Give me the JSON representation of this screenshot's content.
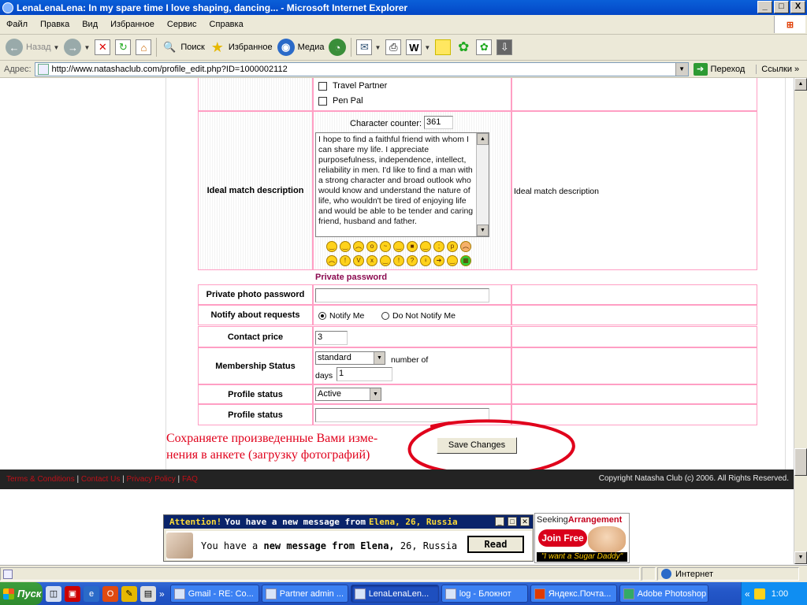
{
  "window": {
    "title": "LenaLenaLena: In my spare time I love shaping, dancing... - Microsoft Internet Explorer",
    "min": "_",
    "max": "□",
    "close": "X"
  },
  "menu": [
    "Файл",
    "Правка",
    "Вид",
    "Избранное",
    "Сервис",
    "Справка"
  ],
  "toolbar": {
    "back": "Назад",
    "search": "Поиск",
    "favorites": "Избранное",
    "media": "Медиа"
  },
  "address": {
    "label": "Адрес:",
    "url": "http://www.natashaclub.com/profile_edit.php?ID=1000002112",
    "go": "Переход",
    "links": "Ссылки"
  },
  "form": {
    "purpose_options": [
      {
        "label": "Travel Partner",
        "checked": false
      },
      {
        "label": "Pen Pal",
        "checked": false
      }
    ],
    "counter_label": "Character counter:",
    "counter_value": "361",
    "ideal_label": "Ideal match description",
    "ideal_text": "I hope to find a faithful friend with whom I can share my life. I appreciate purposefulness, independence, intellect, reliability in men. I'd like to find a man with a strong character and broad outlook who would know and understand the nature of life, who wouldn't be tired of enjoying life and would be able to be tender and caring friend, husband and father.",
    "ideal_note": "Ideal match description",
    "private_header": "Private password",
    "private_label": "Private photo password",
    "private_value": "",
    "notify_label": "Notify about requests",
    "notify_on": "Notify Me",
    "notify_off": "Do Not Notify Me",
    "price_label": "Contact price",
    "price_value": "3",
    "membership_label": "Membership Status",
    "membership_value": "standard",
    "membership_days_pre": "number of",
    "membership_days_label": "days",
    "membership_days_value": "1",
    "profile_status_label": "Profile status",
    "profile_status_value": "Active",
    "profile_status2_label": "Profile status",
    "profile_status2_value": "",
    "save": "Save Changes"
  },
  "annotation": {
    "line1": "Сохраняете произведенные Вами изме-",
    "line2": "нения в анкете (загрузку фотографий)",
    "circle_color": "#e0001b"
  },
  "footer": {
    "links": [
      "Terms & Conditions",
      "Contact Us",
      "Privacy Policy",
      "FAQ"
    ],
    "copyright": "Copyright Natasha Club (c) 2006. All Rights Reserved."
  },
  "ad": {
    "att": "Attention!",
    "head_text": "You have a new message from",
    "head_name": "Elena, 26, Russia",
    "body_pre": "You have a",
    "body_bold": "new message from Elena,",
    "body_post": "26, Russia",
    "read": "Read"
  },
  "seeking": {
    "brand_a": "Seeking",
    "brand_b": "Arrangement",
    "join": "Join Free",
    "tagline": "\"I want a Sugar Daddy\""
  },
  "status": {
    "zone": "Интернет"
  },
  "taskbar": {
    "start": "Пуск",
    "tasks": [
      {
        "label": "Gmail - RE: Co...",
        "active": false
      },
      {
        "label": "Partner admin ...",
        "active": false
      },
      {
        "label": "LenaLenaLen...",
        "active": true
      },
      {
        "label": "log - Блокнот",
        "active": false
      },
      {
        "label": "Яндекс.Почта...",
        "active": false
      },
      {
        "label": "Adobe Photoshop",
        "active": false
      }
    ],
    "time": "1:00"
  },
  "colors": {
    "title_bar": "#0347c6",
    "table_border": "#ff9fc4",
    "accent_purple": "#8b0a50",
    "footer_bg": "#232323",
    "footer_link": "#c01018"
  }
}
